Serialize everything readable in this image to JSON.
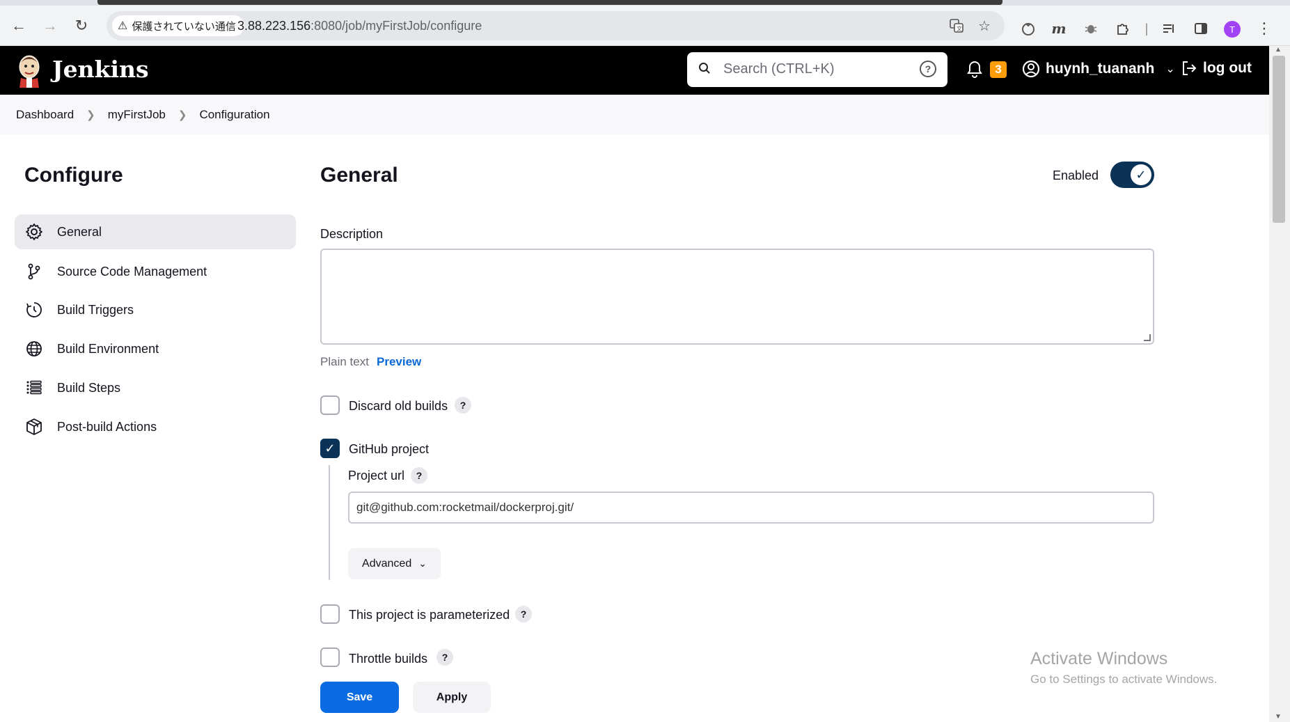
{
  "browser": {
    "security_label": "保護されていない通信",
    "url_host": "3.88.223.156",
    "url_rest": ":8080/job/myFirstJob/configure",
    "profile_initial": "T"
  },
  "header": {
    "app_title": "Jenkins",
    "search_placeholder": "Search (CTRL+K)",
    "notification_count": "3",
    "username": "huynh_tuananh",
    "logout_label": "log out"
  },
  "breadcrumb": [
    "Dashboard",
    "myFirstJob",
    "Configuration"
  ],
  "sidebar": {
    "title": "Configure",
    "items": [
      {
        "label": "General",
        "icon": "gear-icon",
        "active": true
      },
      {
        "label": "Source Code Management",
        "icon": "branch-icon"
      },
      {
        "label": "Build Triggers",
        "icon": "clock-icon"
      },
      {
        "label": "Build Environment",
        "icon": "globe-icon"
      },
      {
        "label": "Build Steps",
        "icon": "list-icon"
      },
      {
        "label": "Post-build Actions",
        "icon": "package-icon"
      }
    ]
  },
  "main": {
    "title": "General",
    "enabled_label": "Enabled",
    "enabled": true,
    "description_label": "Description",
    "description_value": "",
    "plain_text_label": "Plain text",
    "preview_label": "Preview",
    "options": [
      {
        "label": "Discard old builds",
        "checked": false
      },
      {
        "label": "GitHub project",
        "checked": true
      },
      {
        "label": "This project is parameterized",
        "checked": false
      },
      {
        "label": "Throttle builds",
        "checked": false
      }
    ],
    "project_url_label": "Project url",
    "project_url_value": "git@github.com:rocketmail/dockerproj.git/",
    "advanced_label": "Advanced"
  },
  "actions": {
    "save_label": "Save",
    "apply_label": "Apply"
  },
  "watermark": {
    "line1": "Activate Windows",
    "line2": "Go to Settings to activate Windows."
  },
  "colors": {
    "accent_dark": "#0b3357",
    "save_blue": "#0b6be3",
    "notification": "#fe9d0c",
    "link": "#0a69d6"
  }
}
